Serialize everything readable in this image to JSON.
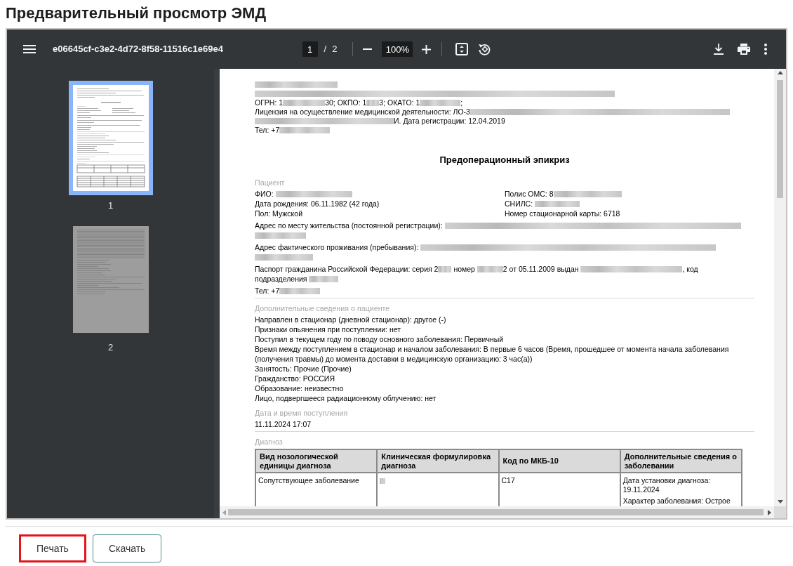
{
  "page_title": "Предварительный просмотр ЭМД",
  "viewer": {
    "toolbar": {
      "file_name": "e06645cf-c3e2-4d72-8f58-11516c1e69e4",
      "page_number": "1",
      "page_separator": "/",
      "page_count": "2",
      "zoom": "100%"
    },
    "thumbnails": [
      {
        "label": "1",
        "selected": true
      },
      {
        "label": "2",
        "selected": false
      }
    ],
    "document": {
      "header": [
        [
          {
            "kind": "blurred"
          }
        ],
        [
          {
            "kind": "blurred"
          }
        ],
        [
          {
            "kind": "text",
            "text": "ОГРН: 1"
          },
          {
            "kind": "blurred"
          },
          {
            "kind": "text",
            "text": "30; ОКПО: 1"
          },
          {
            "kind": "blurred"
          },
          {
            "kind": "text",
            "text": "3; ОКАТО: 1"
          },
          {
            "kind": "blurred"
          },
          {
            "kind": "text",
            "text": ";"
          }
        ],
        [
          {
            "kind": "text",
            "text": "Лицензия на осуществление медицинской деятельности: ЛО-3"
          },
          {
            "kind": "blurred"
          },
          {
            "kind": "blurred"
          },
          {
            "kind": "text",
            "text": "И. Дата регистрации: 12.04.2019"
          }
        ],
        [
          {
            "kind": "text",
            "text": "Тел: +7"
          },
          {
            "kind": "blurred"
          }
        ]
      ],
      "title": "Предоперационный эпикриз",
      "sections": [
        {
          "label": "Пациент",
          "ruled": true,
          "blocks": [
            {
              "kind": "columns",
              "left": [
                [
                  {
                    "kind": "text",
                    "text": "ФИО: "
                  },
                  {
                    "kind": "blurred"
                  }
                ],
                [
                  {
                    "kind": "text",
                    "text": "Дата рождения: 06.11.1982 (42 года)"
                  }
                ],
                [
                  {
                    "kind": "text",
                    "text": "Пол: Мужской"
                  }
                ]
              ],
              "right": [
                [
                  {
                    "kind": "text",
                    "text": "Полис ОМС: 8"
                  },
                  {
                    "kind": "blurred"
                  }
                ],
                [
                  {
                    "kind": "text",
                    "text": "СНИЛС: "
                  },
                  {
                    "kind": "blurred"
                  }
                ],
                [
                  {
                    "kind": "text",
                    "text": "Номер стационарной карты: 6718"
                  }
                ]
              ]
            },
            {
              "kind": "paragraph",
              "segments": [
                {
                  "kind": "text",
                  "text": "Адрес по месту жительства (постоянной регистрации): "
                },
                {
                  "kind": "blurred"
                },
                {
                  "kind": "blurred"
                }
              ]
            },
            {
              "kind": "paragraph",
              "segments": [
                {
                  "kind": "text",
                  "text": "Адрес фактического проживания (пребывания): "
                },
                {
                  "kind": "blurred"
                },
                {
                  "kind": "blurred"
                }
              ]
            },
            {
              "kind": "paragraph",
              "segments": [
                {
                  "kind": "text",
                  "text": "Паспорт гражданина Российской Федерации: серия 2"
                },
                {
                  "kind": "blurred"
                },
                {
                  "kind": "text",
                  "text": " номер "
                },
                {
                  "kind": "blurred"
                },
                {
                  "kind": "text",
                  "text": "2 от 05.11.2009 выдан "
                },
                {
                  "kind": "blurred"
                },
                {
                  "kind": "text",
                  "text": ", код "
                },
                {
                  "kind": "text",
                  "text": "подразделения "
                },
                {
                  "kind": "blurred"
                }
              ]
            },
            {
              "kind": "paragraph",
              "segments": [
                {
                  "kind": "text",
                  "text": "Тел: +7"
                },
                {
                  "kind": "blurred"
                }
              ]
            }
          ]
        },
        {
          "label": "Дополнительные сведения о пациенте",
          "ruled": false,
          "blocks": [
            {
              "kind": "line",
              "segments": [
                {
                  "kind": "text",
                  "text": "Направлен в стационар (дневной стационар): другое (-)"
                }
              ]
            },
            {
              "kind": "line",
              "segments": [
                {
                  "kind": "text",
                  "text": "Признаки опьянения при поступлении: нет"
                }
              ]
            },
            {
              "kind": "line",
              "segments": [
                {
                  "kind": "text",
                  "text": "Поступил в текущем году по поводу основного заболевания: Первичный"
                }
              ]
            },
            {
              "kind": "line",
              "segments": [
                {
                  "kind": "text",
                  "text": "Время между поступлением в стационар и началом заболевания: В первые 6 часов (Время, прошедшее от момента начала заболевания (получения травмы) до момента доставки в медицинскую организацию: 3 час(а))"
                }
              ]
            },
            {
              "kind": "line",
              "segments": [
                {
                  "kind": "text",
                  "text": "Занятость: Прочие (Прочие)"
                }
              ]
            },
            {
              "kind": "line",
              "segments": [
                {
                  "kind": "text",
                  "text": "Гражданство: РОССИЯ"
                }
              ]
            },
            {
              "kind": "line",
              "segments": [
                {
                  "kind": "text",
                  "text": "Образование: неизвестно"
                }
              ]
            },
            {
              "kind": "line",
              "segments": [
                {
                  "kind": "text",
                  "text": "Лицо, подвергшееся радиационному облучению: нет"
                }
              ]
            }
          ]
        },
        {
          "label": "Дата и время поступления",
          "ruled": true,
          "blocks": [
            {
              "kind": "line",
              "segments": [
                {
                  "kind": "text",
                  "text": "11.11.2024 17:07"
                }
              ]
            }
          ]
        },
        {
          "label": "Диагноз",
          "ruled": false,
          "blocks": [
            {
              "kind": "table",
              "columns": [
                "Вид нозологической единицы диагноза",
                "Клиническая формулировка диагноза",
                "Код по МКБ-10",
                "Дополнительные сведения о заболевании"
              ],
              "rows": [
                {
                  "cells": [
                    [
                      [
                        {
                          "kind": "text",
                          "text": "Сопутствующее заболевание"
                        }
                      ]
                    ],
                    [
                      [
                        {
                          "kind": "blurred"
                        }
                      ]
                    ],
                    [
                      [
                        {
                          "kind": "text",
                          "text": "C17"
                        }
                      ]
                    ],
                    [
                      [
                        {
                          "kind": "text",
                          "text": "Дата установки диагноза: 19.11.2024"
                        }
                      ],
                      [
                        {
                          "kind": "text",
                          "text": "Характер заболевания: Острое"
                        }
                      ]
                    ]
                  ]
                }
              ]
            }
          ]
        }
      ]
    }
  },
  "buttons": [
    {
      "label": "Печать",
      "highlighted": true
    },
    {
      "label": "Скачать",
      "highlighted": false
    }
  ]
}
